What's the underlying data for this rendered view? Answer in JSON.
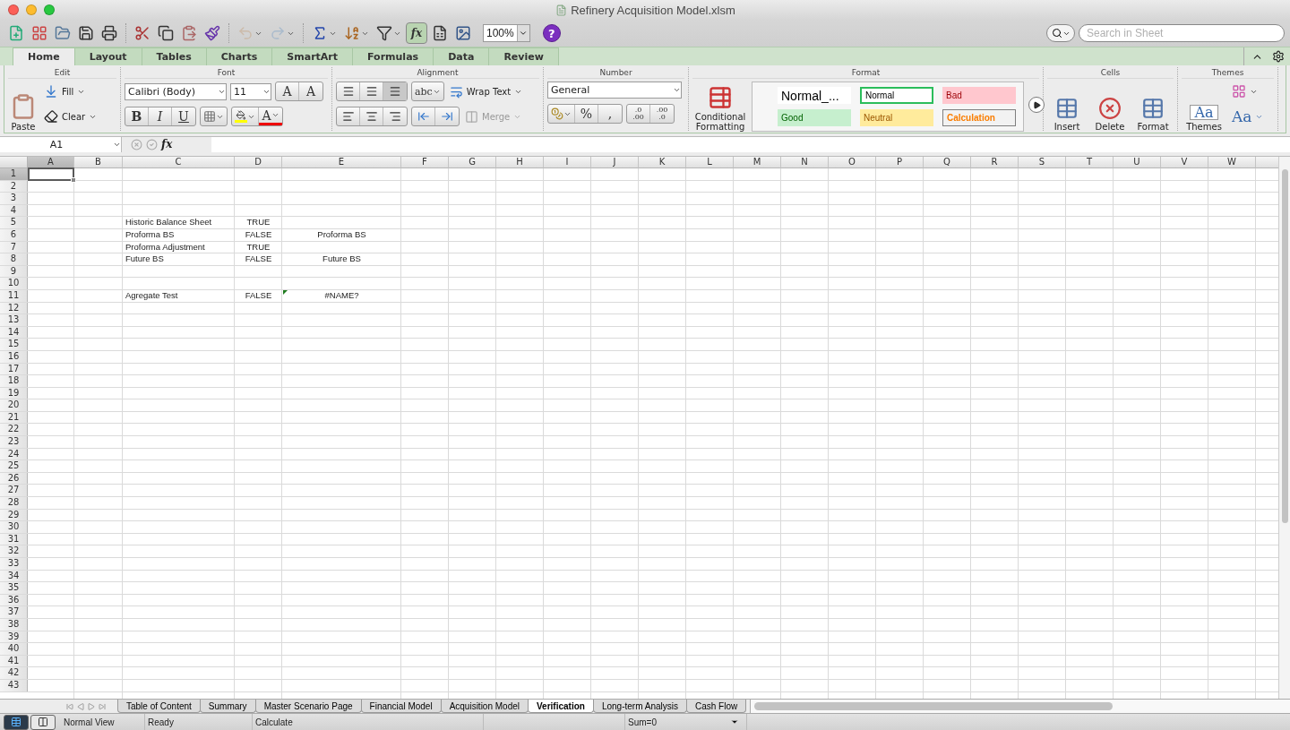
{
  "window": {
    "title": "Refinery Acquisition Model.xlsm"
  },
  "toolbar": {
    "zoom": "100%",
    "formula_button": "fx",
    "help": "?",
    "search": {
      "placeholder": "Search in Sheet"
    }
  },
  "ribbon": {
    "tabs": [
      {
        "label": "Home",
        "selected": true
      },
      {
        "label": "Layout",
        "selected": false
      },
      {
        "label": "Tables",
        "selected": false
      },
      {
        "label": "Charts",
        "selected": false
      },
      {
        "label": "SmartArt",
        "selected": false
      },
      {
        "label": "Formulas",
        "selected": false
      },
      {
        "label": "Data",
        "selected": false
      },
      {
        "label": "Review",
        "selected": false
      }
    ],
    "edit": {
      "label": "Edit",
      "paste": "Paste",
      "fill": "Fill",
      "clear": "Clear"
    },
    "font": {
      "label": "Font",
      "name": "Calibri (Body)",
      "size": "11",
      "grow": "A",
      "shrink": "A",
      "bold": "B",
      "italic": "I",
      "underline": "U",
      "color_button": "A"
    },
    "alignment": {
      "label": "Alignment",
      "orientation": "abc",
      "wrap": "Wrap Text",
      "merge": {
        "label": "Merge",
        "disabled": true
      }
    },
    "number": {
      "label": "Number",
      "format": "General",
      "percent": "%",
      "comma": ",",
      "decimals": [
        {
          "top": ".0",
          "bottom": ".00"
        },
        {
          "top": ".00",
          "bottom": ".0"
        }
      ]
    },
    "format": {
      "label": "Format",
      "conditional": "Conditional Formatting",
      "styles": [
        {
          "label": "Normal_...",
          "kind": "preview",
          "color": "#ffffff",
          "selected": false
        },
        {
          "label": "Normal",
          "kind": "normal",
          "color": "#ffffff",
          "selected": true
        },
        {
          "label": "Bad",
          "kind": "bad",
          "color": "#ffc7ce",
          "selected": false
        },
        {
          "label": "Good",
          "kind": "good",
          "color": "#c6efce",
          "selected": false
        },
        {
          "label": "Neutral",
          "kind": "neutral",
          "color": "#ffeb9c",
          "selected": false
        },
        {
          "label": "Calculation",
          "kind": "calculation",
          "color": "#f2f2f2",
          "selected": false
        }
      ]
    },
    "cells": {
      "label": "Cells",
      "buttons": [
        "Insert",
        "Delete",
        "Format"
      ]
    },
    "themes": {
      "label": "Themes",
      "themes": "Themes",
      "theme_icon": "Aa",
      "fonts": "Aa"
    }
  },
  "formula_bar": {
    "name_box": "A1",
    "fx": "fx"
  },
  "sheet": {
    "columns": [
      {
        "label": "A",
        "selected": true
      },
      {
        "label": "B",
        "selected": false
      },
      {
        "label": "C",
        "selected": false
      },
      {
        "label": "D",
        "selected": false
      },
      {
        "label": "E",
        "selected": false
      },
      {
        "label": "F",
        "selected": false
      },
      {
        "label": "G",
        "selected": false
      },
      {
        "label": "H",
        "selected": false
      },
      {
        "label": "I",
        "selected": false
      },
      {
        "label": "J",
        "selected": false
      },
      {
        "label": "K",
        "selected": false
      },
      {
        "label": "L",
        "selected": false
      },
      {
        "label": "M",
        "selected": false
      },
      {
        "label": "N",
        "selected": false
      },
      {
        "label": "O",
        "selected": false
      },
      {
        "label": "P",
        "selected": false
      },
      {
        "label": "Q",
        "selected": false
      },
      {
        "label": "R",
        "selected": false
      },
      {
        "label": "S",
        "selected": false
      },
      {
        "label": "T",
        "selected": false
      },
      {
        "label": "U",
        "selected": false
      },
      {
        "label": "V",
        "selected": false
      },
      {
        "label": "W",
        "selected": false
      }
    ],
    "rows": [
      {
        "header": "1",
        "selected": true
      },
      {
        "header": "2",
        "selected": false
      },
      {
        "header": "3",
        "selected": false
      },
      {
        "header": "4",
        "selected": false
      },
      {
        "header": "5",
        "selected": false,
        "cells": [
          null,
          null,
          {
            "text": "Historic Balance Sheet",
            "kind": "label"
          },
          {
            "text": "TRUE",
            "kind": "value"
          }
        ]
      },
      {
        "header": "6",
        "selected": false,
        "cells": [
          null,
          null,
          {
            "text": "Proforma BS",
            "kind": "label"
          },
          {
            "text": "FALSE",
            "kind": "value"
          },
          {
            "text": "Proforma BS",
            "kind": "value"
          }
        ]
      },
      {
        "header": "7",
        "selected": false,
        "cells": [
          null,
          null,
          {
            "text": "Proforma Adjustment",
            "kind": "label"
          },
          {
            "text": "TRUE",
            "kind": "value"
          }
        ]
      },
      {
        "header": "8",
        "selected": false,
        "cells": [
          null,
          null,
          {
            "text": "Future BS",
            "kind": "label"
          },
          {
            "text": "FALSE",
            "kind": "value"
          },
          {
            "text": "Future BS",
            "kind": "value"
          }
        ]
      },
      {
        "header": "9",
        "selected": false
      },
      {
        "header": "10",
        "selected": false
      },
      {
        "header": "11",
        "selected": false,
        "cells": [
          null,
          null,
          {
            "text": "Agregate Test",
            "kind": "label"
          },
          {
            "text": "FALSE",
            "kind": "value"
          },
          {
            "text": "#NAME?",
            "kind": "value",
            "error_flag": true
          }
        ]
      },
      {
        "header": "12",
        "selected": false
      },
      {
        "header": "13",
        "selected": false
      },
      {
        "header": "14",
        "selected": false
      },
      {
        "header": "15",
        "selected": false
      },
      {
        "header": "16",
        "selected": false
      },
      {
        "header": "17",
        "selected": false
      },
      {
        "header": "18",
        "selected": false
      },
      {
        "header": "19",
        "selected": false
      },
      {
        "header": "20",
        "selected": false
      },
      {
        "header": "21",
        "selected": false
      },
      {
        "header": "22",
        "selected": false
      },
      {
        "header": "23",
        "selected": false
      },
      {
        "header": "24",
        "selected": false
      },
      {
        "header": "25",
        "selected": false
      },
      {
        "header": "26",
        "selected": false
      },
      {
        "header": "27",
        "selected": false
      },
      {
        "header": "28",
        "selected": false
      },
      {
        "header": "29",
        "selected": false
      },
      {
        "header": "30",
        "selected": false
      },
      {
        "header": "31",
        "selected": false
      },
      {
        "header": "32",
        "selected": false
      },
      {
        "header": "33",
        "selected": false
      },
      {
        "header": "34",
        "selected": false
      },
      {
        "header": "35",
        "selected": false
      },
      {
        "header": "36",
        "selected": false
      },
      {
        "header": "37",
        "selected": false
      },
      {
        "header": "38",
        "selected": false
      },
      {
        "header": "39",
        "selected": false
      },
      {
        "header": "40",
        "selected": false
      },
      {
        "header": "41",
        "selected": false
      },
      {
        "header": "42",
        "selected": false
      },
      {
        "header": "43",
        "selected": false
      }
    ]
  },
  "sheet_tabs": [
    {
      "label": "Table of Content",
      "selected": false
    },
    {
      "label": "Summary",
      "selected": false
    },
    {
      "label": "Master Scenario Page",
      "selected": false
    },
    {
      "label": "Financial Model",
      "selected": false
    },
    {
      "label": "Acquisition Model",
      "selected": false
    },
    {
      "label": "Verification",
      "selected": true
    },
    {
      "label": "Long-term Analysis",
      "selected": false
    },
    {
      "label": "Cash Flow",
      "selected": false
    }
  ],
  "status_bar": {
    "views": [
      {
        "kind": "normal",
        "selected": true
      },
      {
        "kind": "page_layout",
        "selected": false
      }
    ],
    "view": "Normal View",
    "state": "Ready",
    "mode": "Calculate",
    "sum": "Sum=0"
  }
}
